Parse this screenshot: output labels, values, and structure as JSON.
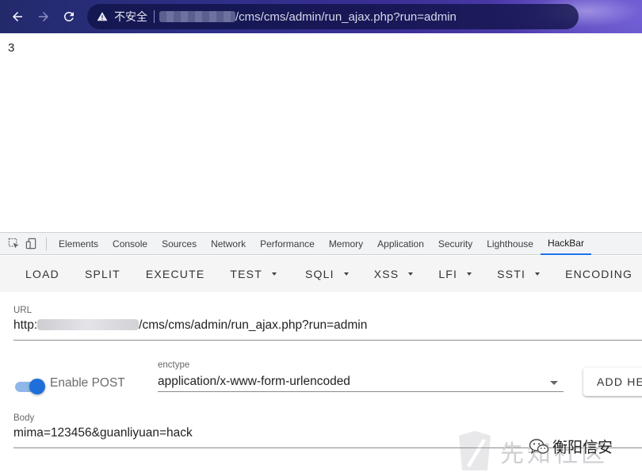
{
  "browser": {
    "back_icon": "arrow-left-icon",
    "forward_icon": "arrow-right-icon",
    "reload_icon": "reload-icon",
    "security_icon": "warning-triangle-icon",
    "security_label": "不安全",
    "url_visible": "/cms/cms/admin/run_ajax.php?run=admin"
  },
  "page": {
    "output": "3"
  },
  "devtools": {
    "tabs": [
      "Elements",
      "Console",
      "Sources",
      "Network",
      "Performance",
      "Memory",
      "Application",
      "Security",
      "Lighthouse",
      "HackBar"
    ],
    "active_tab": "HackBar"
  },
  "hackbar": {
    "buttons": {
      "load": "LOAD",
      "split": "SPLIT",
      "execute": "EXECUTE",
      "test": "TEST",
      "sqli": "SQLI",
      "xss": "XSS",
      "lfi": "LFI",
      "ssti": "SSTI",
      "encoding": "ENCODING"
    },
    "url_label": "URL",
    "url_prefix": "http:",
    "url_suffix": "/cms/cms/admin/run_ajax.php?run=admin",
    "enable_post_label": "Enable POST",
    "enable_post": true,
    "enctype_label": "enctype",
    "enctype_value": "application/x-www-form-urlencoded",
    "add_header_label": "ADD HEADER",
    "body_label": "Body",
    "body_value": "mima=123456&guanliyuan=hack"
  },
  "watermark": {
    "background_text": "先知社区",
    "account": "衡阳信安"
  },
  "colors": {
    "accent": "#1a73e8",
    "switch_thumb": "#1e6fd9",
    "switch_track": "#8fb8e9"
  }
}
